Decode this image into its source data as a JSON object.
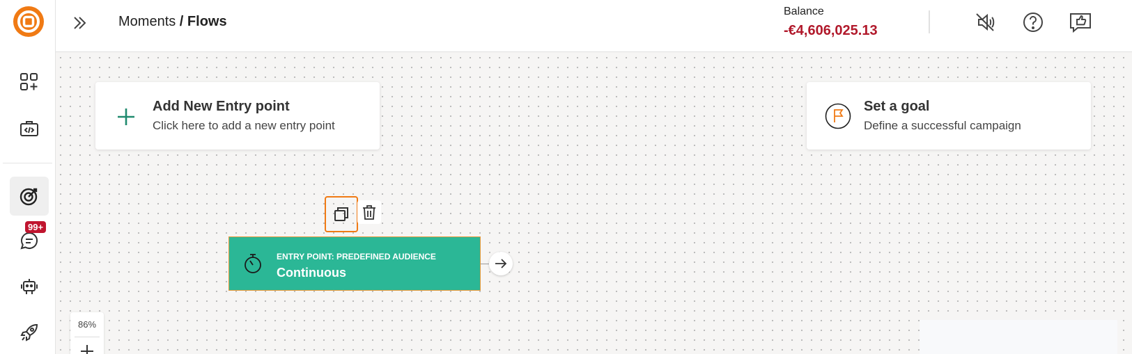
{
  "rail": {
    "notification_count": "99+"
  },
  "header": {
    "breadcrumb_parent": "Moments",
    "breadcrumb_separator": " / ",
    "breadcrumb_current": "Flows",
    "balance_label": "Balance",
    "balance_value": "-€4,606,025.13"
  },
  "canvas": {
    "add_entry": {
      "title": "Add New Entry point",
      "subtitle": "Click here to add a new entry point"
    },
    "goal": {
      "title": "Set a goal",
      "subtitle": "Define a successful campaign"
    },
    "entry_node": {
      "label": "ENTRY POINT: PREDEFINED AUDIENCE",
      "value": "Continuous"
    },
    "zoom_level": "86%"
  },
  "colors": {
    "brand_orange": "#f07a14",
    "entry_green": "#2bb796",
    "balance_red": "#b1192b",
    "badge_red": "#c0152f"
  }
}
